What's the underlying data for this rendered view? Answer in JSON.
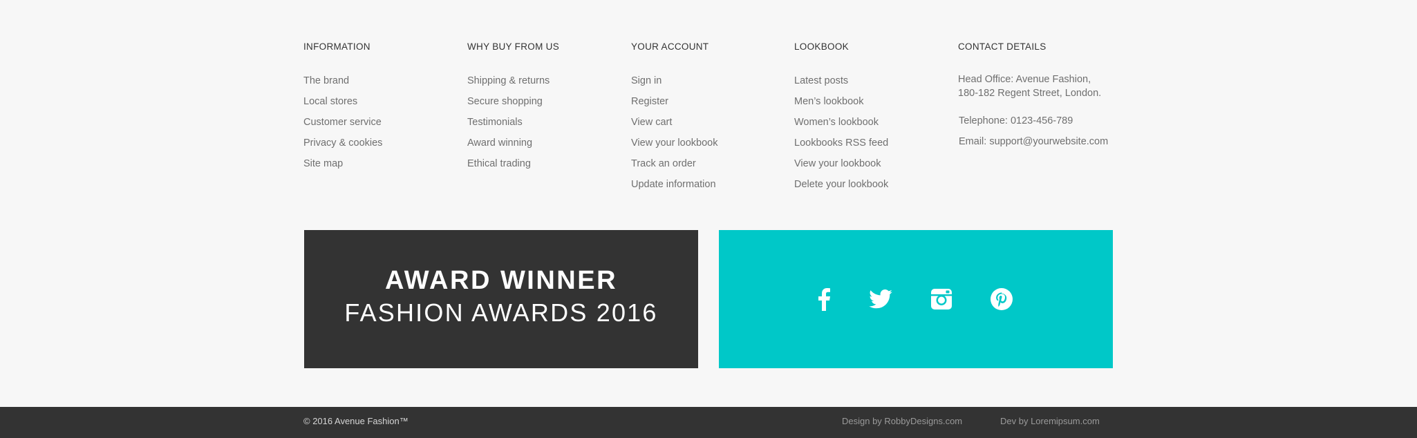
{
  "columns": {
    "information": {
      "heading": "INFORMATION",
      "links": [
        "The brand",
        "Local stores",
        "Customer service",
        "Privacy & cookies",
        "Site map"
      ]
    },
    "why_buy": {
      "heading": "WHY BUY FROM US",
      "links": [
        "Shipping & returns",
        "Secure shopping",
        "Testimonials",
        "Award winning",
        "Ethical trading"
      ]
    },
    "account": {
      "heading": "YOUR ACCOUNT",
      "links": [
        "Sign in",
        "Register",
        "View cart",
        "View your lookbook",
        "Track an order",
        "Update information"
      ]
    },
    "lookbook": {
      "heading": "LOOKBOOK",
      "links": [
        "Latest posts",
        "Men’s lookbook",
        "Women’s lookbook",
        "Lookbooks RSS feed",
        "View your lookbook",
        "Delete your lookbook"
      ]
    },
    "contact": {
      "heading": "CONTACT DETAILS",
      "address_line1": "Head Office: Avenue Fashion,",
      "address_line2": "180-182 Regent Street, London.",
      "telephone": "Telephone: 0123-456-789",
      "email": "Email: support@yourwebsite.com"
    }
  },
  "award": {
    "title": "AWARD WINNER",
    "subtitle": "FASHION AWARDS 2016",
    "background": "#333333"
  },
  "social": {
    "background": "#00c8c8",
    "icons": [
      "facebook-icon",
      "twitter-icon",
      "instagram-icon",
      "pinterest-icon"
    ]
  },
  "bottom_bar": {
    "copyright": "© 2016 Avenue Fashion™",
    "design_credit": "Design by RobbyDesigns.com",
    "dev_credit": "Dev by Loremipsum.com"
  }
}
